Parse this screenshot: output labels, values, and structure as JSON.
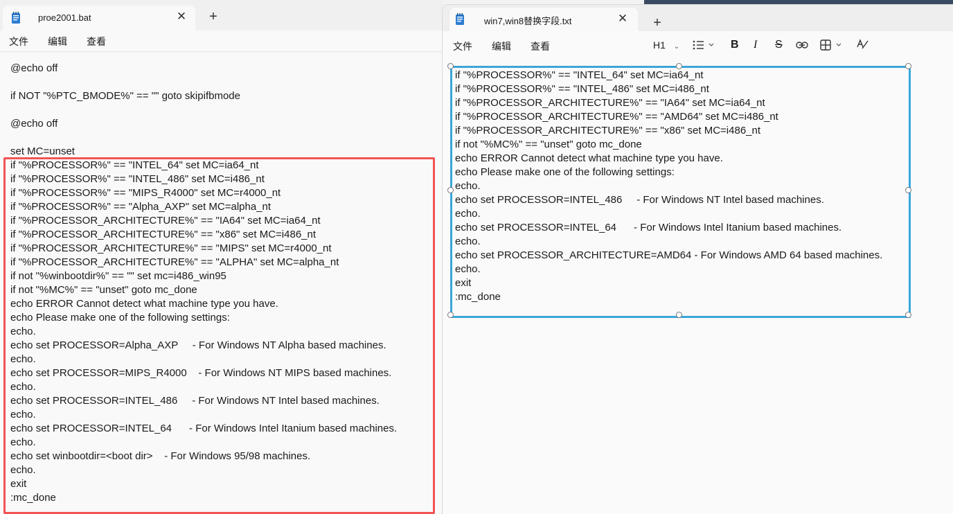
{
  "left_window": {
    "tab_title": "proe2001.bat",
    "menu": [
      "文件",
      "编辑",
      "查看"
    ],
    "lines": [
      "@echo off",
      "",
      "if NOT \"%PTC_BMODE%\" == \"\" goto skipifbmode",
      "",
      "@echo off",
      "",
      "set MC=unset",
      "if \"%PROCESSOR%\" == \"INTEL_64\" set MC=ia64_nt",
      "if \"%PROCESSOR%\" == \"INTEL_486\" set MC=i486_nt",
      "if \"%PROCESSOR%\" == \"MIPS_R4000\" set MC=r4000_nt",
      "if \"%PROCESSOR%\" == \"Alpha_AXP\" set MC=alpha_nt",
      "if \"%PROCESSOR_ARCHITECTURE%\" == \"IA64\" set MC=ia64_nt",
      "if \"%PROCESSOR_ARCHITECTURE%\" == \"x86\" set MC=i486_nt",
      "if \"%PROCESSOR_ARCHITECTURE%\" == \"MIPS\" set MC=r4000_nt",
      "if \"%PROCESSOR_ARCHITECTURE%\" == \"ALPHA\" set MC=alpha_nt",
      "if not \"%winbootdir%\" == \"\" set mc=i486_win95",
      "if not \"%MC%\" == \"unset\" goto mc_done",
      "echo ERROR Cannot detect what machine type you have.",
      "echo Please make one of the following settings:",
      "echo.",
      "echo set PROCESSOR=Alpha_AXP     - For Windows NT Alpha based machines.",
      "echo.",
      "echo set PROCESSOR=MIPS_R4000    - For Windows NT MIPS based machines.",
      "echo.",
      "echo set PROCESSOR=INTEL_486     - For Windows NT Intel based machines.",
      "echo.",
      "echo set PROCESSOR=INTEL_64      - For Windows Intel Itanium based machines.",
      "echo.",
      "echo set winbootdir=<boot dir>    - For Windows 95/98 machines.",
      "echo.",
      "exit",
      ":mc_done"
    ]
  },
  "right_window": {
    "tab_title": "win7,win8替换字段.txt",
    "menu": [
      "文件",
      "编辑",
      "查看"
    ],
    "heading_select": "H1",
    "toolbar_icons": [
      "list-icon",
      "bold-icon",
      "italic-icon",
      "strikethrough-icon",
      "link-icon",
      "table-icon",
      "spellcheck-icon"
    ],
    "lines": [
      "if \"%PROCESSOR%\" == \"INTEL_64\" set MC=ia64_nt",
      "if \"%PROCESSOR%\" == \"INTEL_486\" set MC=i486_nt",
      "if \"%PROCESSOR_ARCHITECTURE%\" == \"IA64\" set MC=ia64_nt",
      "if \"%PROCESSOR_ARCHITECTURE%\" == \"AMD64\" set MC=i486_nt",
      "if \"%PROCESSOR_ARCHITECTURE%\" == \"x86\" set MC=i486_nt",
      "if not \"%MC%\" == \"unset\" goto mc_done",
      "echo ERROR Cannot detect what machine type you have.",
      "echo Please make one of the following settings:",
      "echo.",
      "echo set PROCESSOR=INTEL_486     - For Windows NT Intel based machines.",
      "echo.",
      "echo set PROCESSOR=INTEL_64      - For Windows Intel Itanium based machines.",
      "echo.",
      "echo set PROCESSOR_ARCHITECTURE=AMD64 - For Windows AMD 64 based machines.",
      "echo.",
      "exit",
      ":mc_done"
    ]
  },
  "colors": {
    "highlight_box": "#f25454",
    "selection_frame": "#3aa6db"
  }
}
